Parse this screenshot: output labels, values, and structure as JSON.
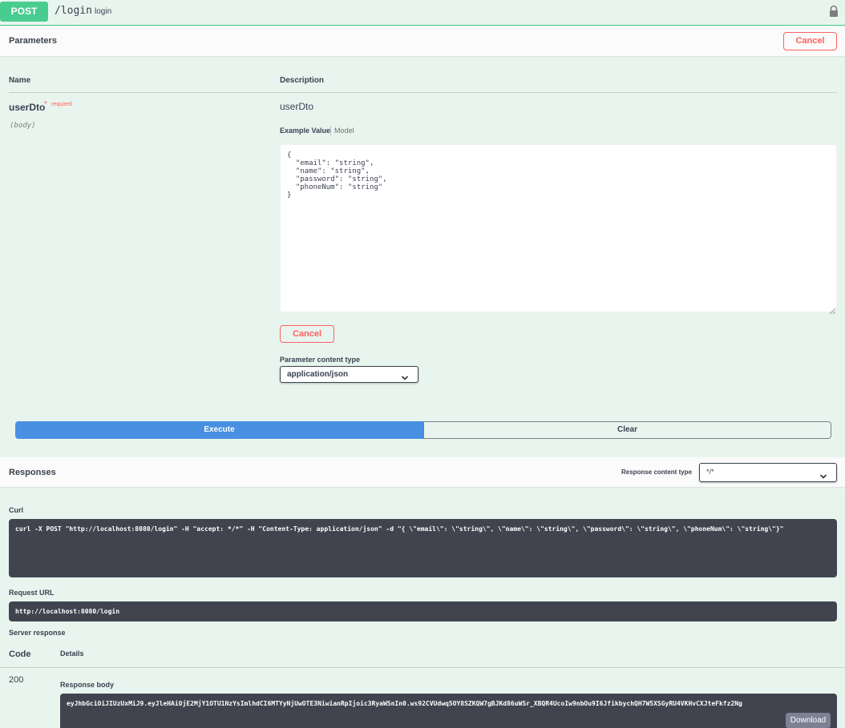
{
  "operation": {
    "method": "POST",
    "path": "/login",
    "summary": "login"
  },
  "parameters": {
    "title": "Parameters",
    "cancel_label": "Cancel",
    "col_name": "Name",
    "col_description": "Description",
    "param": {
      "name": "userDto",
      "required_star": "*",
      "required_label": "required",
      "in": "(body)",
      "description": "userDto",
      "tab_example": "Example Value",
      "tab_model": "Model",
      "body_value": "{\n  \"email\": \"string\",\n  \"name\": \"string\",\n  \"password\": \"string\",\n  \"phoneNum\": \"string\"\n}"
    },
    "cancel_mid_label": "Cancel",
    "content_type_label": "Parameter content type",
    "content_type_value": "application/json"
  },
  "actions": {
    "execute_label": "Execute",
    "clear_label": "Clear"
  },
  "responses": {
    "title": "Responses",
    "content_type_label": "Response content type",
    "content_type_value": "*/*",
    "curl_label": "Curl",
    "curl_command": "curl -X POST \"http://localhost:8080/login\" -H \"accept: */*\" -H \"Content-Type: application/json\" -d \"{ \\\"email\\\": \\\"string\\\", \\\"name\\\": \\\"string\\\", \\\"password\\\": \\\"string\\\", \\\"phoneNum\\\": \\\"string\\\"}\"",
    "request_url_label": "Request URL",
    "request_url": "http://localhost:8080/login",
    "server_response_label": "Server response",
    "code_header": "Code",
    "details_header": "Details",
    "code": "200",
    "response_body_label": "Response body",
    "response_body": "eyJhbGciOiJIUzUxMiJ9.eyJleHAiOjE2MjY1OTU1NzYsImlhdCI6MTYyNjUwOTE3NiwianRpIjoic3RyaW5nIn0.ws92CVUdwq5OY8SZKQW7gBJKd86uWSr_XBQR4UcoIw9nbOu9I6JfikbychQH7W5XSGyRU4VKHvCXJteFkfz2Ng",
    "download_label": "Download"
  },
  "colors": {
    "post_green": "#49cc90",
    "cancel_red": "#ff6060",
    "execute_blue": "#4990e2",
    "code_bg": "#41444e"
  }
}
